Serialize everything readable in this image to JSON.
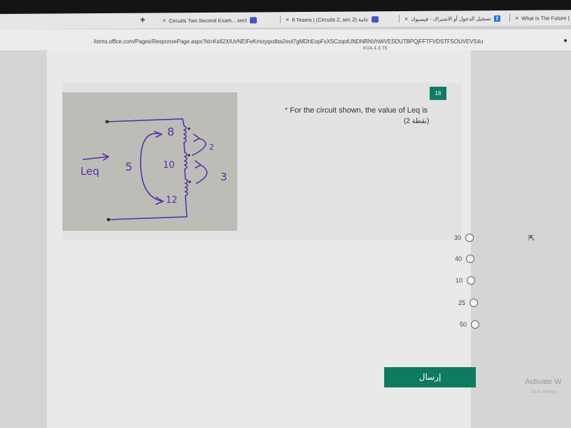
{
  "browser": {
    "new_tab_glyph": "+",
    "tabs": [
      {
        "label": "Circuits Two Second Exam... sect",
        "close": "×"
      },
      {
        "label": "ft Teams | (Circuits 2, sec 2) عامة",
        "close": "×"
      },
      {
        "label": "تسجيل الدخول أو الاشتراك - فيسبوك",
        "close": "×"
      },
      {
        "label": "What Is The Future (",
        "close": "×"
      }
    ],
    "url": "forms.office.com/Pages/ResponsePage.aspx?id=Ks62XIUvNEIFeKmoyqxdbw2eol7gMDhEopFxXSCzqotUNDNRNVhWVESDUTBPQjFFTFVDSTFSOUVEVS4u"
  },
  "form": {
    "peek_text": "KVA 4.3 70",
    "question": {
      "number": "16",
      "required_marker": "*",
      "text": "For the circuit shown, the value of Leq is",
      "points": "(2 نقطة)",
      "figure": {
        "labels": [
          "8",
          "2",
          "Leq",
          "5",
          "10",
          "3",
          "12"
        ]
      },
      "options": [
        {
          "label": "30"
        },
        {
          "label": "40"
        },
        {
          "label": "10"
        },
        {
          "label": "25"
        },
        {
          "label": "50"
        }
      ]
    },
    "submit_label": "إرسال"
  },
  "watermark": {
    "line1": "Activate W",
    "line2": "Go to Settings"
  },
  "colors": {
    "accent": "#107c65",
    "submit": "#0e7a5f",
    "ink": "#5a2ea8"
  }
}
